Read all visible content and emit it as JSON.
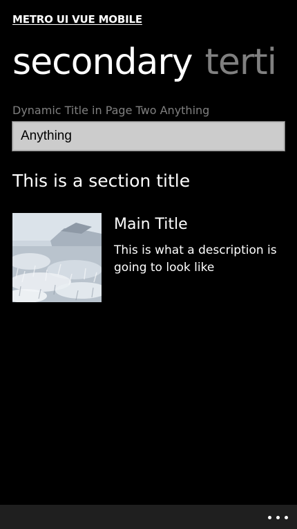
{
  "app": {
    "title": "METRO UI VUE MOBILE"
  },
  "pivot": {
    "items": [
      {
        "label": "secondary",
        "active": true
      },
      {
        "label": "terti",
        "active": false
      }
    ]
  },
  "form": {
    "dynamic_label": "Dynamic Title in Page Two Anything",
    "input_value": "Anything"
  },
  "section": {
    "title": "This is a section title"
  },
  "list": {
    "items": [
      {
        "thumbnail": "frost-field-photo",
        "title": "Main Title",
        "description": "This is what a description is going to look like"
      }
    ]
  },
  "app_bar": {
    "more_icon": "ellipsis-icon"
  },
  "colors": {
    "background": "#000000",
    "text": "#ffffff",
    "muted": "#808080",
    "input_bg": "#cccccc",
    "app_bar_bg": "#1f1f1f"
  }
}
